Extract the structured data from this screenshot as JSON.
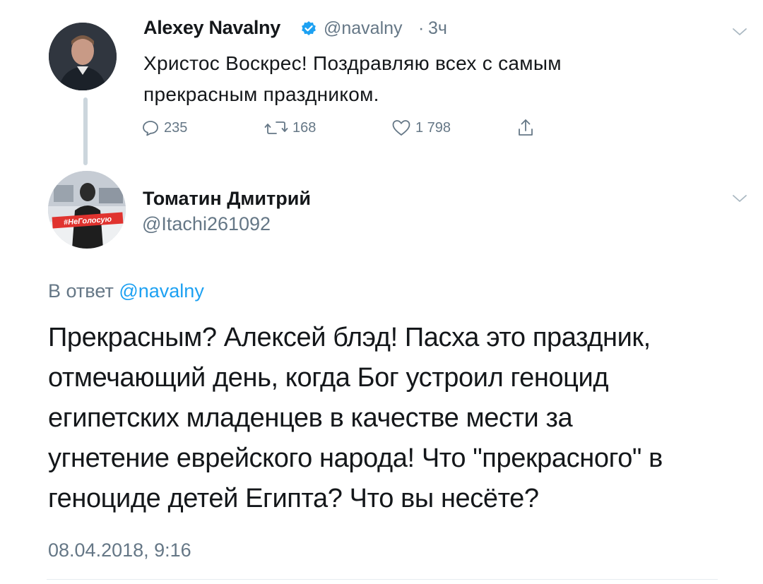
{
  "parent_tweet": {
    "author_name": "Alexey Navalny",
    "handle": "@navalny",
    "dot": "·",
    "time": "3ч",
    "text": "Христос Воскрес! Поздравляю всех с самым прекрасным праздником.",
    "actions": {
      "replies": "235",
      "retweets": "168",
      "likes": "1 798"
    }
  },
  "reply_tweet": {
    "author_name": "Томатин Дмитрий",
    "handle": "@Itachi261092",
    "avatar_badge": "#НеГолосую",
    "reply_to_prefix": "В ответ",
    "reply_to_handle": "@navalny",
    "text_lines": [
      "Прекрасным? Алексей блэд! Пасха это праздник,",
      "отмечающий день, когда Бог устроил геноцид",
      "египетских младенцев в качестве мести за",
      "угнетение еврейского народа! Что \"прекрасного\" в",
      "геноциде детей Египта? Что вы несёте?"
    ],
    "timestamp": "08.04.2018, 9:16"
  },
  "colors": {
    "accent": "#1da1f2",
    "secondary_text": "#657786",
    "primary_text": "#14171a",
    "thread_line": "#ccd6dd"
  },
  "icons": {
    "verified": "verified-badge-icon",
    "menu": "chevron-down-icon",
    "reply": "reply-icon",
    "retweet": "retweet-icon",
    "like": "heart-icon",
    "share": "share-icon"
  }
}
